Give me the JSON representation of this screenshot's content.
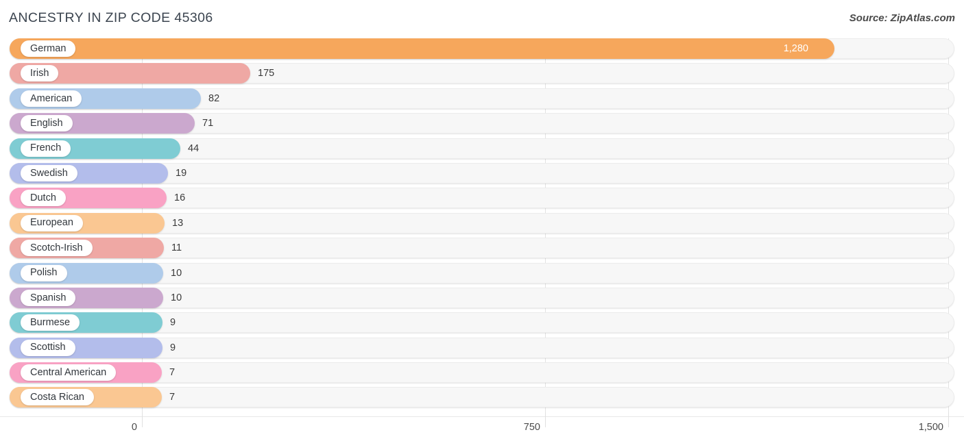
{
  "header": {
    "title": "ANCESTRY IN ZIP CODE 45306",
    "source": "Source: ZipAtlas.com"
  },
  "axis": {
    "ticks": [
      "0",
      "750",
      "1,500"
    ]
  },
  "chart_data": {
    "type": "bar",
    "orientation": "horizontal",
    "title": "ANCESTRY IN ZIP CODE 45306",
    "subtitle": "Source: ZipAtlas.com",
    "xlabel": "",
    "ylabel": "",
    "xlim": [
      0,
      1500
    ],
    "xticks": [
      0,
      750,
      1500
    ],
    "xtick_labels": [
      "0",
      "750",
      "1,500"
    ],
    "grid": true,
    "legend": "none",
    "categories": [
      "German",
      "Irish",
      "American",
      "English",
      "French",
      "Swedish",
      "Dutch",
      "European",
      "Scotch-Irish",
      "Polish",
      "Spanish",
      "Burmese",
      "Scottish",
      "Central American",
      "Costa Rican"
    ],
    "values": [
      1280,
      175,
      82,
      71,
      44,
      19,
      16,
      13,
      11,
      10,
      10,
      9,
      9,
      7,
      7
    ],
    "value_labels": [
      "1,280",
      "175",
      "82",
      "71",
      "44",
      "19",
      "16",
      "13",
      "11",
      "10",
      "10",
      "9",
      "9",
      "7",
      "7"
    ],
    "colors": [
      "#F6A75C",
      "#EFA8A4",
      "#AFCBEA",
      "#CBA8CE",
      "#7FCCD3",
      "#B3BDEB",
      "#F9A2C4",
      "#FAC792",
      "#EFA8A4",
      "#AFCBEA",
      "#CBA8CE",
      "#7FCCD3",
      "#B3BDEB",
      "#F9A2C4",
      "#FAC792"
    ]
  },
  "rows": [
    {
      "label": "German",
      "value": "1,280",
      "num": 1280,
      "color": "#F6A75C",
      "bar": 1203,
      "inside": true
    },
    {
      "label": "Irish",
      "value": "175",
      "num": 175,
      "color": "#EFA8A4",
      "bar": 351,
      "inside": false
    },
    {
      "label": "American",
      "value": "82",
      "num": 82,
      "color": "#AFCBEA",
      "bar": 279,
      "inside": false
    },
    {
      "label": "English",
      "value": "71",
      "num": 71,
      "color": "#CBA8CE",
      "bar": 270,
      "inside": false
    },
    {
      "label": "French",
      "value": "44",
      "num": 44,
      "color": "#7FCCD3",
      "bar": 249,
      "inside": false
    },
    {
      "label": "Swedish",
      "value": "19",
      "num": 19,
      "color": "#B3BDEB",
      "bar": 231,
      "inside": false
    },
    {
      "label": "Dutch",
      "value": "16",
      "num": 16,
      "color": "#F9A2C4",
      "bar": 229,
      "inside": false
    },
    {
      "label": "European",
      "value": "13",
      "num": 13,
      "color": "#FAC792",
      "bar": 226,
      "inside": false
    },
    {
      "label": "Scotch-Irish",
      "value": "11",
      "num": 11,
      "color": "#EFA8A4",
      "bar": 225,
      "inside": false
    },
    {
      "label": "Polish",
      "value": "10",
      "num": 10,
      "color": "#AFCBEA",
      "bar": 224,
      "inside": false
    },
    {
      "label": "Spanish",
      "value": "10",
      "num": 10,
      "color": "#CBA8CE",
      "bar": 224,
      "inside": false
    },
    {
      "label": "Burmese",
      "value": "9",
      "num": 9,
      "color": "#7FCCD3",
      "bar": 223,
      "inside": false
    },
    {
      "label": "Scottish",
      "value": "9",
      "num": 9,
      "color": "#B3BDEB",
      "bar": 223,
      "inside": false
    },
    {
      "label": "Central American",
      "value": "7",
      "num": 7,
      "color": "#F9A2C4",
      "bar": 222,
      "inside": false
    },
    {
      "label": "Costa Rican",
      "value": "7",
      "num": 7,
      "color": "#FAC792",
      "bar": 222,
      "inside": false
    }
  ],
  "gridline_positions": [
    207,
    795,
    1383
  ]
}
